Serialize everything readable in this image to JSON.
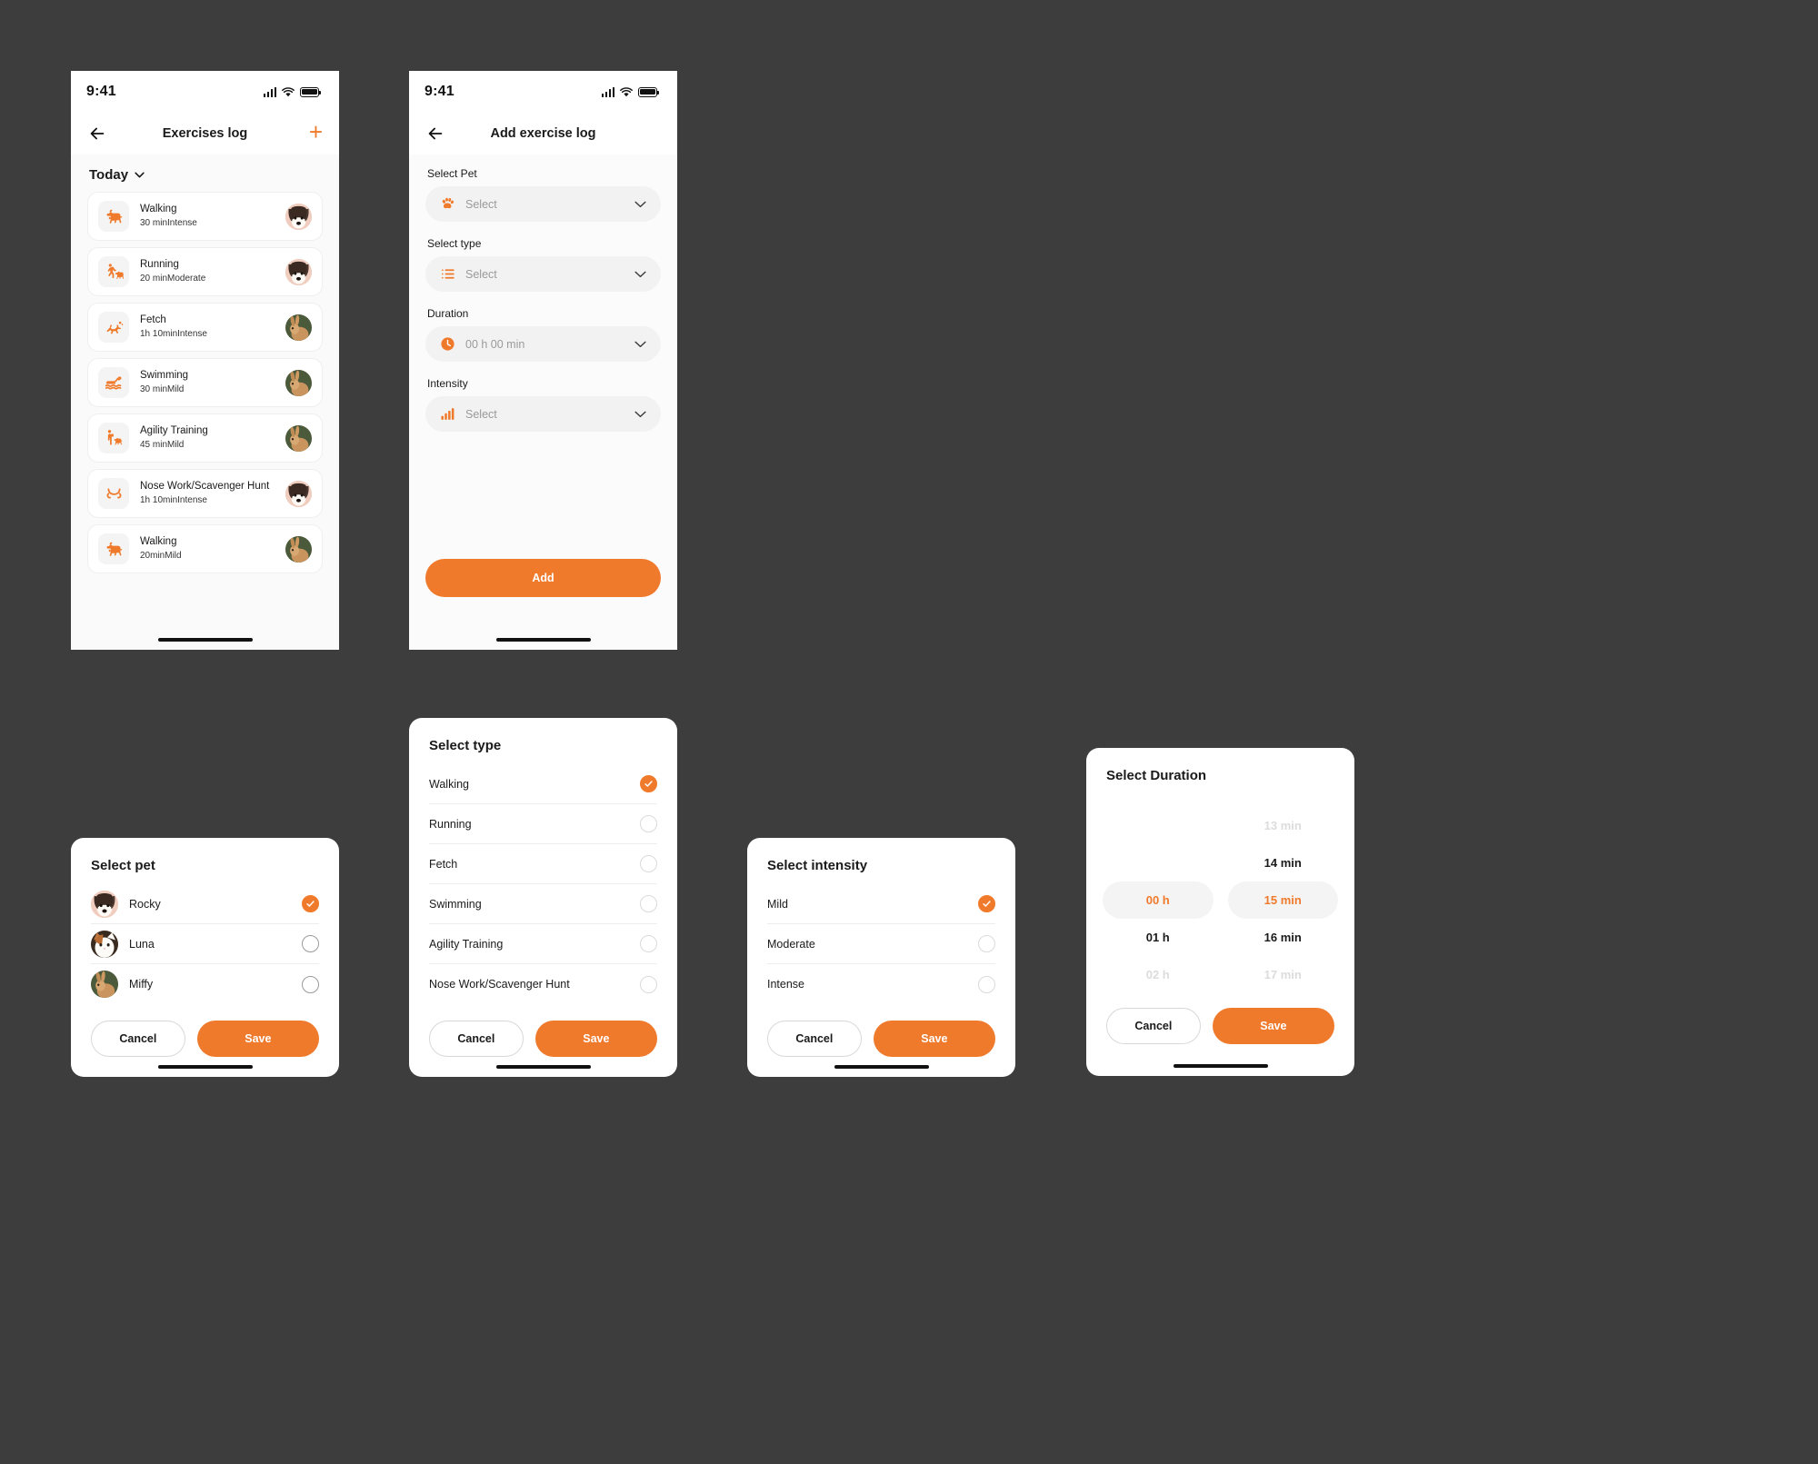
{
  "theme": {
    "accent": "#F07A2B",
    "bg": "#3d3d3d",
    "surface": "#ffffff",
    "muted": "#f2f2f2",
    "placeholder": "#9a9a9a"
  },
  "status_bar": {
    "time": "9:41"
  },
  "screen_list": {
    "title": "Exercises log",
    "add_label": "+",
    "group_label": "Today",
    "items": [
      {
        "name": "Walking",
        "duration": "30 min",
        "intensity": "Intense",
        "icon": "dog-walk-icon"
      },
      {
        "name": "Running",
        "duration": "20 min",
        "intensity": "Moderate",
        "icon": "person-dog-run-icon"
      },
      {
        "name": "Fetch",
        "duration": "1h 10min",
        "intensity": "Intense",
        "icon": "dog-jump-icon"
      },
      {
        "name": "Swimming",
        "duration": "30 min",
        "intensity": "Mild",
        "icon": "dog-swim-icon"
      },
      {
        "name": "Agility Training",
        "duration": "45 min",
        "intensity": "Mild",
        "icon": "person-dog-train-icon"
      },
      {
        "name": "Nose Work/Scavenger Hunt",
        "duration": "1h 10min",
        "intensity": "Intense",
        "icon": "dog-nose-icon"
      },
      {
        "name": "Walking",
        "duration": "20min",
        "intensity": "Mild",
        "icon": "dog-walk-icon"
      }
    ]
  },
  "screen_form": {
    "title": "Add exercise log",
    "fields": [
      {
        "label": "Select Pet",
        "value": "Select",
        "icon": "paw-icon"
      },
      {
        "label": "Select type",
        "value": "Select",
        "icon": "list-icon"
      },
      {
        "label": "Duration",
        "value": "00 h 00 min",
        "icon": "clock-icon"
      },
      {
        "label": "Intensity",
        "value": "Select",
        "icon": "bars-icon"
      }
    ],
    "submit_label": "Add"
  },
  "modal_pet": {
    "title": "Select pet",
    "options": [
      {
        "label": "Rocky",
        "selected": true,
        "avatar": "dog-avatar"
      },
      {
        "label": "Luna",
        "selected": false,
        "avatar": "cat-avatar"
      },
      {
        "label": "Miffy",
        "selected": false,
        "avatar": "rabbit-avatar"
      }
    ],
    "cancel_label": "Cancel",
    "save_label": "Save"
  },
  "modal_type": {
    "title": "Select type",
    "options": [
      {
        "label": "Walking",
        "selected": true
      },
      {
        "label": "Running",
        "selected": false
      },
      {
        "label": "Fetch",
        "selected": false
      },
      {
        "label": "Swimming",
        "selected": false
      },
      {
        "label": "Agility Training",
        "selected": false
      },
      {
        "label": "Nose Work/Scavenger Hunt",
        "selected": false
      }
    ],
    "cancel_label": "Cancel",
    "save_label": "Save"
  },
  "modal_intensity": {
    "title": "Select intensity",
    "options": [
      {
        "label": "Mild",
        "selected": true
      },
      {
        "label": "Moderate",
        "selected": false
      },
      {
        "label": "Intense",
        "selected": false
      }
    ],
    "cancel_label": "Cancel",
    "save_label": "Save"
  },
  "modal_duration": {
    "title": "Select Duration",
    "hours": [
      {
        "label": "",
        "state": "blank"
      },
      {
        "label": "",
        "state": "blank"
      },
      {
        "label": "00 h",
        "state": "sel"
      },
      {
        "label": "01 h",
        "state": "norm"
      },
      {
        "label": "02 h",
        "state": "dim"
      }
    ],
    "minutes": [
      {
        "label": "13 min",
        "state": "dim"
      },
      {
        "label": "14 min",
        "state": "norm"
      },
      {
        "label": "15 min",
        "state": "sel"
      },
      {
        "label": "16 min",
        "state": "norm"
      },
      {
        "label": "17 min",
        "state": "dim"
      }
    ],
    "cancel_label": "Cancel",
    "save_label": "Save"
  }
}
